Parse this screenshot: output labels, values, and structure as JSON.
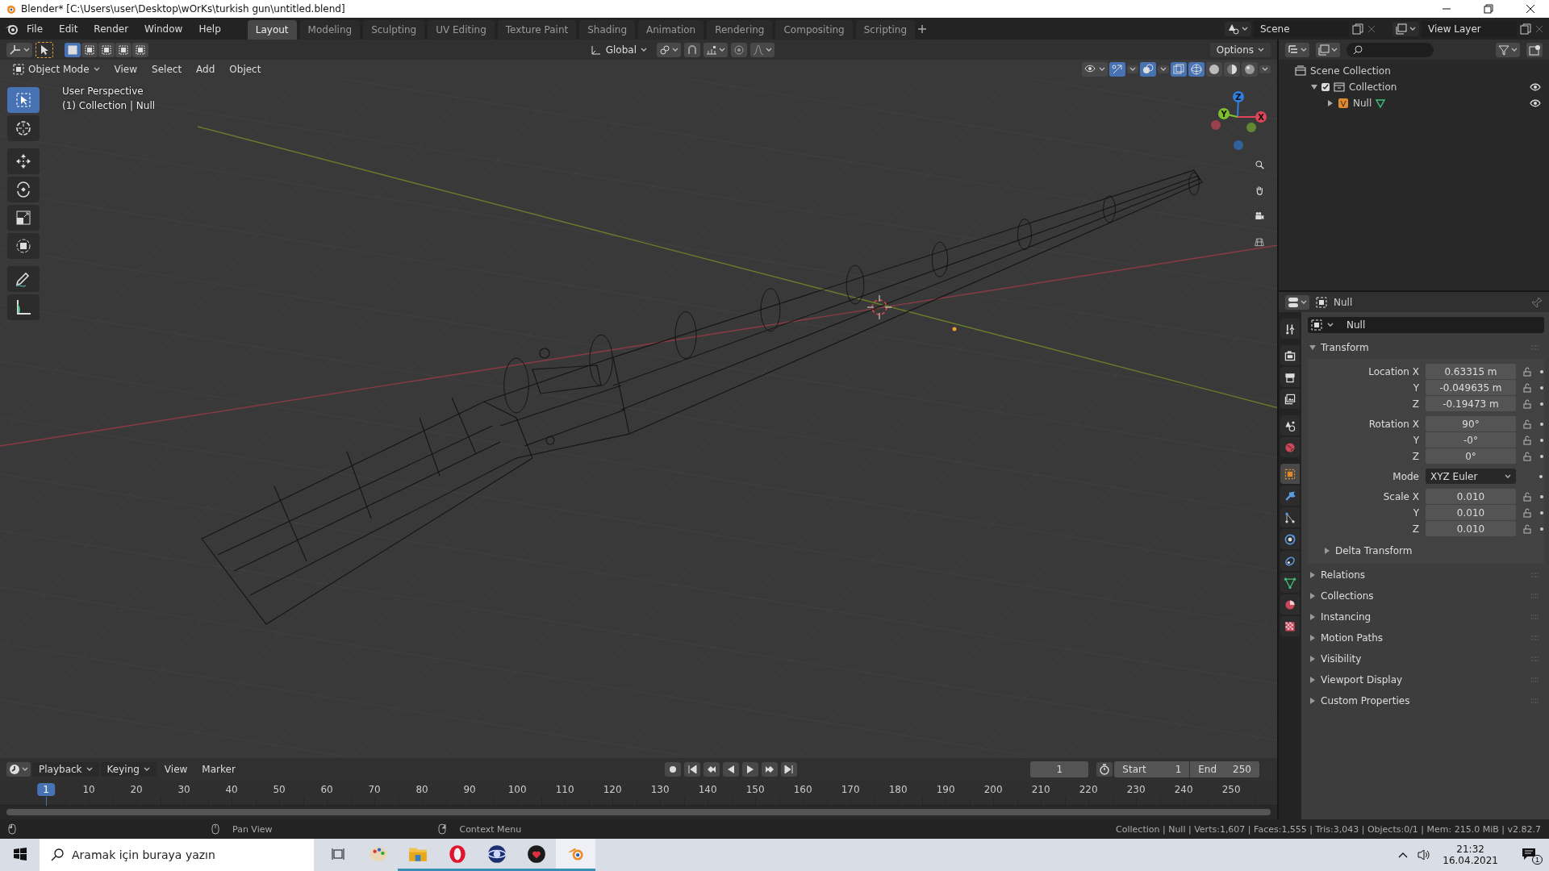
{
  "window": {
    "title": "Blender* [C:\\Users\\user\\Desktop\\wOrKs\\turkish gun\\untitled.blend]"
  },
  "menu": [
    "File",
    "Edit",
    "Render",
    "Window",
    "Help"
  ],
  "workspaces": [
    {
      "label": "Layout",
      "selected": true
    },
    {
      "label": "Modeling",
      "selected": false
    },
    {
      "label": "Sculpting",
      "selected": false
    },
    {
      "label": "UV Editing",
      "selected": false
    },
    {
      "label": "Texture Paint",
      "selected": false
    },
    {
      "label": "Shading",
      "selected": false
    },
    {
      "label": "Animation",
      "selected": false
    },
    {
      "label": "Rendering",
      "selected": false
    },
    {
      "label": "Compositing",
      "selected": false
    },
    {
      "label": "Scripting",
      "selected": false
    }
  ],
  "scene": "Scene",
  "view_layer": "View Layer",
  "viewport": {
    "orientation": "Global",
    "options": "Options",
    "mode": "Object Mode",
    "menus": [
      "View",
      "Select",
      "Add",
      "Object"
    ],
    "overlay_text": [
      "User Perspective",
      "(1) Collection | Null"
    ],
    "tools": [
      {
        "kind": "select",
        "selected": true
      },
      {
        "kind": "cursor",
        "selected": false
      },
      {
        "kind": "move",
        "selected": false
      },
      {
        "kind": "rotate",
        "selected": false
      },
      {
        "kind": "scale",
        "selected": false
      },
      {
        "kind": "transform",
        "selected": false
      },
      {
        "kind": "annotate",
        "selected": false
      },
      {
        "kind": "measure",
        "selected": false
      }
    ],
    "gizmo_axes": [
      {
        "label": "Z",
        "color": "#2f7fe0"
      },
      {
        "label": "Y",
        "color": "#7fbf2f"
      },
      {
        "label": "X",
        "color": "#e0455a"
      }
    ]
  },
  "outliner": {
    "items": [
      {
        "label": "Scene Collection",
        "kind": "scene",
        "children": [
          {
            "label": "Collection",
            "kind": "collection",
            "expanded": true,
            "checked": true,
            "children": [
              {
                "label": "Null",
                "kind": "empty",
                "expanded": false
              }
            ]
          }
        ]
      }
    ]
  },
  "properties": {
    "object": "Null",
    "name": "Null",
    "tabs": [
      {
        "kind": "tool",
        "selected": false
      },
      {
        "kind": "render",
        "selected": false
      },
      {
        "kind": "output",
        "selected": false
      },
      {
        "kind": "view_layer",
        "selected": false
      },
      {
        "kind": "scene",
        "selected": false
      },
      {
        "kind": "world",
        "selected": false
      },
      {
        "kind": "object",
        "selected": true
      },
      {
        "kind": "modifiers",
        "selected": false
      },
      {
        "kind": "particles",
        "selected": false
      },
      {
        "kind": "physics",
        "selected": false
      },
      {
        "kind": "constraints",
        "selected": false
      },
      {
        "kind": "data",
        "selected": false
      },
      {
        "kind": "material",
        "selected": false
      },
      {
        "kind": "texture",
        "selected": false
      }
    ],
    "transform": {
      "label": "Transform",
      "expanded": true,
      "groups": [
        {
          "kind": "fields",
          "rows": [
            {
              "label": "Location X",
              "value": "0.63315 m"
            },
            {
              "label": "Y",
              "value": "-0.049635 m"
            },
            {
              "label": "Z",
              "value": "-0.19473 m"
            }
          ]
        },
        {
          "kind": "fields",
          "rows": [
            {
              "label": "Rotation X",
              "value": "90°"
            },
            {
              "label": "Y",
              "value": "-0°"
            },
            {
              "label": "Z",
              "value": "0°"
            }
          ]
        },
        {
          "kind": "dropdown",
          "rows": [
            {
              "label": "Mode",
              "value": "XYZ Euler"
            }
          ]
        },
        {
          "kind": "fields",
          "rows": [
            {
              "label": "Scale X",
              "value": "0.010"
            },
            {
              "label": "Y",
              "value": "0.010"
            },
            {
              "label": "Z",
              "value": "0.010"
            }
          ]
        }
      ],
      "subpanels": [
        {
          "label": "Delta Transform",
          "expanded": false
        }
      ]
    },
    "panels": [
      {
        "label": "Relations",
        "expanded": false
      },
      {
        "label": "Collections",
        "expanded": false
      },
      {
        "label": "Instancing",
        "expanded": false
      },
      {
        "label": "Motion Paths",
        "expanded": false
      },
      {
        "label": "Visibility",
        "expanded": false
      },
      {
        "label": "Viewport Display",
        "expanded": false
      },
      {
        "label": "Custom Properties",
        "expanded": false
      }
    ]
  },
  "timeline": {
    "menus": [
      "Playback",
      "Keying",
      "View",
      "Marker"
    ],
    "current_frame": "1",
    "start_label": "Start",
    "start": "1",
    "end_label": "End",
    "end": "250",
    "ticks": [
      "1",
      "10",
      "20",
      "30",
      "40",
      "50",
      "60",
      "70",
      "80",
      "90",
      "100",
      "110",
      "120",
      "130",
      "140",
      "150",
      "160",
      "170",
      "180",
      "190",
      "200",
      "210",
      "220",
      "230",
      "240",
      "250"
    ]
  },
  "status_bar": {
    "hints": [
      "Pan View",
      "Context Menu"
    ],
    "stats": "Collection | Null | Verts:1,607 | Faces:1,555 | Tris:3,043 | Objects:0/1 | Mem: 215.0 MiB | v2.82.7"
  },
  "taskbar": {
    "search_placeholder": "Aramak için buraya yazın",
    "apps": [
      {
        "kind": "paint",
        "running": false,
        "selected": false
      },
      {
        "kind": "folder",
        "running": true,
        "selected": false
      },
      {
        "kind": "opera",
        "running": true,
        "selected": false
      },
      {
        "kind": "sphere",
        "running": true,
        "selected": false
      },
      {
        "kind": "heart",
        "running": true,
        "selected": false
      },
      {
        "kind": "blender",
        "running": true,
        "selected": true
      }
    ],
    "time": "21:32",
    "date": "16.04.2021",
    "notifications": "1"
  }
}
